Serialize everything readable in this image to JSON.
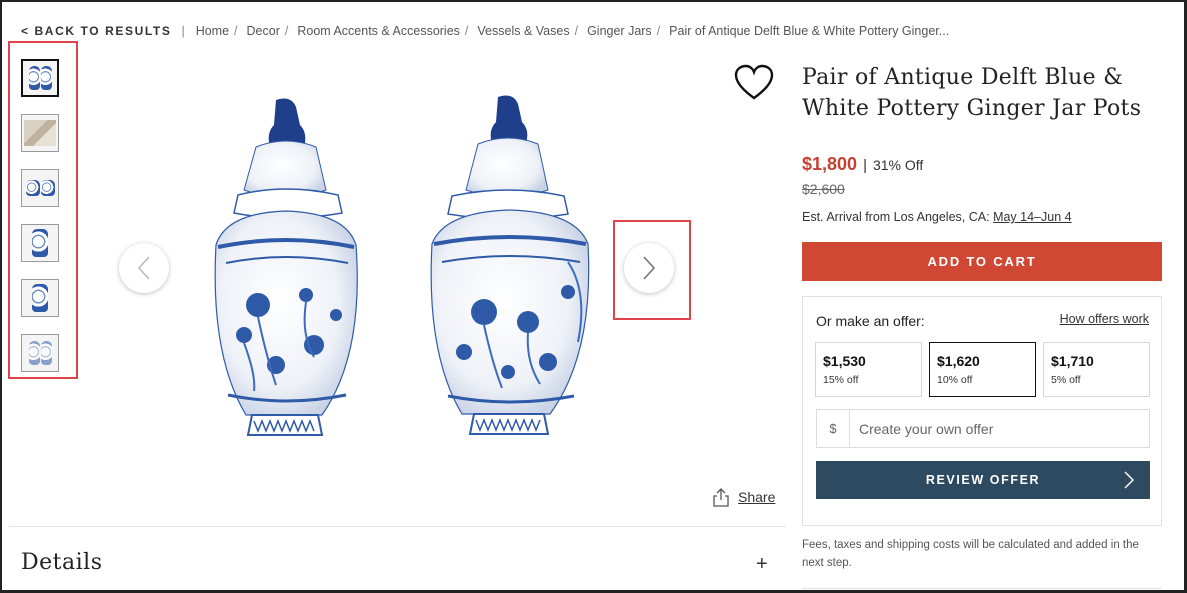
{
  "breadcrumb": {
    "back_label": "< BACK TO RESULTS",
    "separator": "|",
    "items": [
      "Home",
      "Decor",
      "Room Accents & Accessories",
      "Vessels & Vases",
      "Ginger Jars",
      "Pair of Antique Delft Blue & White Pottery Ginger..."
    ],
    "item_separator": "/"
  },
  "gallery": {
    "thumbnail_count": 6,
    "active_index": 0,
    "icons": {
      "prev": "chevron-left-icon",
      "next": "chevron-right-icon",
      "favorite": "heart-icon",
      "share": "share-icon"
    },
    "share_label": "Share"
  },
  "sections": {
    "details_label": "Details",
    "details_toggle": "+"
  },
  "product": {
    "title": "Pair of Antique Delft Blue & White Pottery Ginger Jar Pots",
    "price": "$1,800",
    "price_separator": "|",
    "discount": "31% Off",
    "original_price": "$2,600",
    "arrival_prefix": "Est. Arrival from Los Angeles, CA:",
    "arrival_date": "May 14–Jun 4",
    "add_to_cart_label": "ADD TO CART"
  },
  "offer": {
    "label": "Or make an offer:",
    "how_link": "How offers work",
    "options": [
      {
        "amount": "$1,530",
        "pct": "15% off"
      },
      {
        "amount": "$1,620",
        "pct": "10% off"
      },
      {
        "amount": "$1,710",
        "pct": "5% off"
      }
    ],
    "selected_index": 1,
    "currency_symbol": "$",
    "own_placeholder": "Create your own offer",
    "review_label": "REVIEW OFFER"
  },
  "fees_note": "Fees, taxes and shipping costs will be calculated and added in the next step.",
  "colors": {
    "price_red": "#c8402f",
    "cart_red": "#d04733",
    "review_navy": "#2e4a60",
    "highlight_red": "#e0444b",
    "delft_blue": "#2f5aa8"
  }
}
